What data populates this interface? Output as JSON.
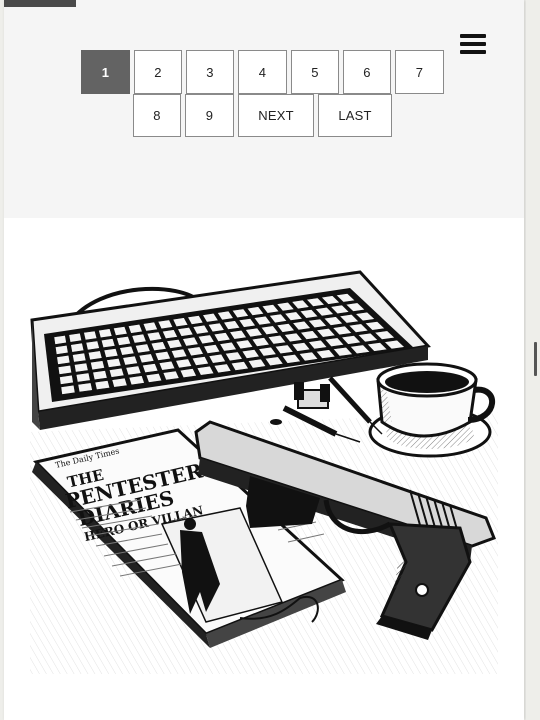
{
  "pagination": {
    "pages": [
      "1",
      "2",
      "3",
      "4",
      "5",
      "6",
      "7",
      "8",
      "9"
    ],
    "current": "1",
    "next_label": "NEXT",
    "last_label": "LAST"
  },
  "header": {
    "menu_icon": "hamburger-menu-icon"
  },
  "illustration": {
    "newspaper_masthead": "The Daily Times",
    "headline_line1": "THE",
    "headline_line2": "PENTESTER",
    "headline_line3": "DIARIES",
    "subheadline": "HERO OR VILLAN",
    "alt": "Pen-and-ink illustration of a keyboard, coffee cup, handgun, syringes and a newspaper"
  },
  "colors": {
    "header_bg": "#f5f5f5",
    "active_page_bg": "#636363",
    "page_border": "#8a8a8a",
    "ink": "#111111"
  }
}
